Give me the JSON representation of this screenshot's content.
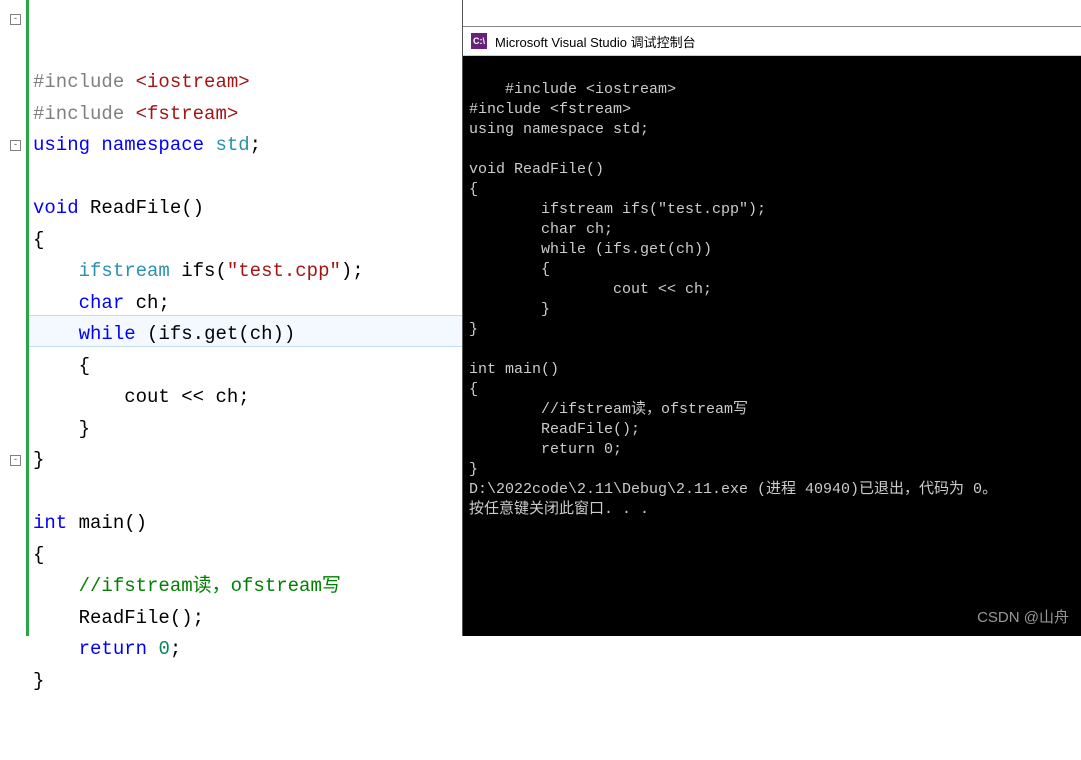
{
  "editor": {
    "lines": [
      {
        "fold": "-",
        "tokens": [
          {
            "t": "#include ",
            "c": "tok-pre"
          },
          {
            "t": "<iostream>",
            "c": "tok-inc"
          }
        ]
      },
      {
        "tokens": [
          {
            "t": "#include ",
            "c": "tok-pre"
          },
          {
            "t": "<fstream>",
            "c": "tok-inc"
          }
        ]
      },
      {
        "tokens": [
          {
            "t": "using ",
            "c": "tok-kw"
          },
          {
            "t": "namespace ",
            "c": "tok-kw"
          },
          {
            "t": "std",
            "c": "tok-type"
          },
          {
            "t": ";",
            "c": "tok-punc"
          }
        ]
      },
      {
        "tokens": []
      },
      {
        "fold": "-",
        "tokens": [
          {
            "t": "void ",
            "c": "tok-kw"
          },
          {
            "t": "ReadFile",
            "c": "tok-id"
          },
          {
            "t": "()",
            "c": "tok-punc"
          }
        ]
      },
      {
        "tokens": [
          {
            "t": "{",
            "c": "tok-punc"
          }
        ]
      },
      {
        "tokens": [
          {
            "t": "    ",
            "c": ""
          },
          {
            "t": "ifstream ",
            "c": "tok-type"
          },
          {
            "t": "ifs",
            "c": "tok-id"
          },
          {
            "t": "(",
            "c": "tok-punc"
          },
          {
            "t": "\"test.cpp\"",
            "c": "tok-str"
          },
          {
            "t": ");",
            "c": "tok-punc"
          }
        ]
      },
      {
        "tokens": [
          {
            "t": "    ",
            "c": ""
          },
          {
            "t": "char ",
            "c": "tok-kw"
          },
          {
            "t": "ch",
            "c": "tok-id"
          },
          {
            "t": ";",
            "c": "tok-punc"
          }
        ]
      },
      {
        "tokens": [
          {
            "t": "    ",
            "c": ""
          },
          {
            "t": "while ",
            "c": "tok-kw"
          },
          {
            "t": "(",
            "c": "tok-punc"
          },
          {
            "t": "ifs",
            "c": "tok-id"
          },
          {
            "t": ".",
            "c": "tok-punc"
          },
          {
            "t": "get",
            "c": "tok-id"
          },
          {
            "t": "(",
            "c": "tok-punc"
          },
          {
            "t": "ch",
            "c": "tok-id"
          },
          {
            "t": "))",
            "c": "tok-punc"
          }
        ]
      },
      {
        "tokens": [
          {
            "t": "    {",
            "c": "tok-punc"
          }
        ]
      },
      {
        "highlight": true,
        "tokens": [
          {
            "t": "        ",
            "c": ""
          },
          {
            "t": "cout",
            "c": "tok-id"
          },
          {
            "t": " << ",
            "c": "tok-punc"
          },
          {
            "t": "ch",
            "c": "tok-id"
          },
          {
            "t": ";",
            "c": "tok-punc"
          }
        ]
      },
      {
        "tokens": [
          {
            "t": "    }",
            "c": "tok-punc"
          }
        ]
      },
      {
        "tokens": [
          {
            "t": "}",
            "c": "tok-punc"
          }
        ]
      },
      {
        "tokens": []
      },
      {
        "fold": "-",
        "tokens": [
          {
            "t": "int ",
            "c": "tok-kw"
          },
          {
            "t": "main",
            "c": "tok-id"
          },
          {
            "t": "()",
            "c": "tok-punc"
          }
        ]
      },
      {
        "tokens": [
          {
            "t": "{",
            "c": "tok-punc"
          }
        ]
      },
      {
        "tokens": [
          {
            "t": "    ",
            "c": ""
          },
          {
            "t": "//ifstream读，ofstream写",
            "c": "tok-cmt"
          }
        ]
      },
      {
        "tokens": [
          {
            "t": "    ",
            "c": ""
          },
          {
            "t": "ReadFile",
            "c": "tok-id"
          },
          {
            "t": "();",
            "c": "tok-punc"
          }
        ]
      },
      {
        "tokens": [
          {
            "t": "    ",
            "c": ""
          },
          {
            "t": "return ",
            "c": "tok-kw"
          },
          {
            "t": "0",
            "c": "tok-num"
          },
          {
            "t": ";",
            "c": "tok-punc"
          }
        ]
      },
      {
        "tokens": [
          {
            "t": "}",
            "c": "tok-punc"
          }
        ]
      }
    ]
  },
  "console": {
    "title": "Microsoft Visual Studio 调试控制台",
    "icon_text": "C:\\",
    "output": "#include <iostream>\n#include <fstream>\nusing namespace std;\n\nvoid ReadFile()\n{\n        ifstream ifs(\"test.cpp\");\n        char ch;\n        while (ifs.get(ch))\n        {\n                cout << ch;\n        }\n}\n\nint main()\n{\n        //ifstream读，ofstream写\n        ReadFile();\n        return 0;\n}\nD:\\2022code\\2.11\\Debug\\2.11.exe (进程 40940)已退出，代码为 0。\n按任意键关闭此窗口. . ."
  },
  "watermark": "CSDN @山舟"
}
